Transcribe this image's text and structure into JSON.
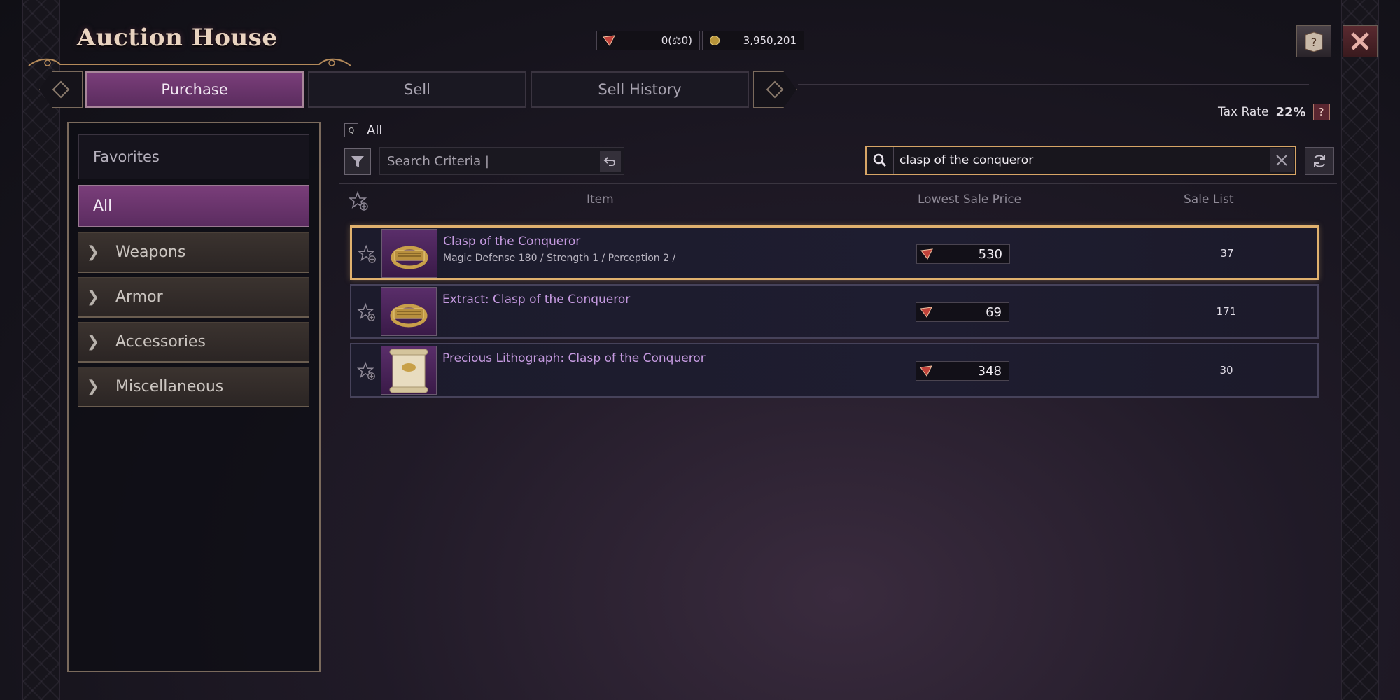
{
  "header": {
    "title": "Auction House",
    "currency_gem": "0(",
    "currency_gem_suffix": "0)",
    "currency_gold": "3,950,201",
    "help_label": "?"
  },
  "tabs": [
    {
      "label": "Purchase",
      "active": true
    },
    {
      "label": "Sell",
      "active": false
    },
    {
      "label": "Sell History",
      "active": false
    }
  ],
  "tax": {
    "label": "Tax Rate",
    "value": "22%",
    "help": "?"
  },
  "sidebar": {
    "favorites": "Favorites",
    "all": "All",
    "categories": [
      "Weapons",
      "Armor",
      "Accessories",
      "Miscellaneous"
    ]
  },
  "filter": {
    "scope_label": "All",
    "criteria_placeholder": "Search Criteria  |"
  },
  "search": {
    "value": "clasp of the conqueror"
  },
  "table": {
    "headers": {
      "item": "Item",
      "price": "Lowest Sale Price",
      "list": "Sale List"
    },
    "rows": [
      {
        "name": "Clasp of the Conqueror",
        "stats": "Magic Defense 180 / Strength 1 / Perception 2 /",
        "price": "530",
        "count": "37",
        "selected": true
      },
      {
        "name": "Extract: Clasp of the Conqueror",
        "stats": "",
        "price": "69",
        "count": "171",
        "selected": false
      },
      {
        "name": "Precious Lithograph: Clasp of the Conqueror",
        "stats": "",
        "price": "348",
        "count": "30",
        "selected": false
      }
    ]
  },
  "colors": {
    "accent": "#7a3e7a",
    "selection": "#e0b16e",
    "item_name": "#c59ae0"
  }
}
